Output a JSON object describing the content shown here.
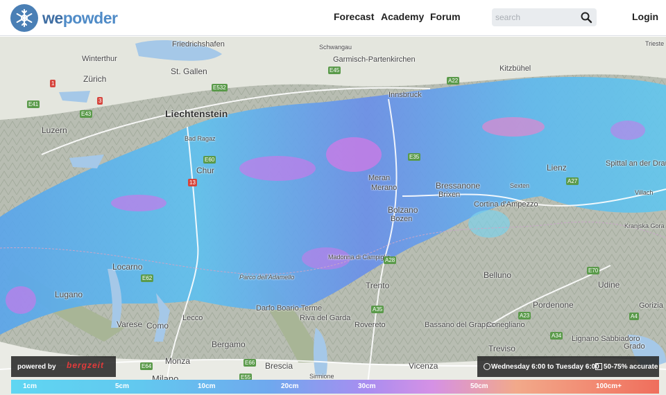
{
  "header": {
    "logo": {
      "we": "we",
      "powder": "powder"
    },
    "nav": [
      "Forecast",
      "Academy",
      "Forum"
    ],
    "search_placeholder": "search",
    "login": "Login"
  },
  "map": {
    "places": [
      "Friedrichshafen",
      "Winterthur",
      "Zürich",
      "St. Gallen",
      "Liechtenstein",
      "Luzern",
      "Chur",
      "Bad Ragaz",
      "Garmisch-Partenkirchen",
      "Innsbruck",
      "Kitzbühel",
      "Meran",
      "Merano",
      "Bressanone",
      "Brixen",
      "Bolzano",
      "Bozen",
      "Lienz",
      "Spittal an der Drau",
      "Cortina d'Ampezzo",
      "Locarno",
      "Lugano",
      "Varese",
      "Como",
      "Lecco",
      "Bergamo",
      "Monza",
      "Milano",
      "Brescia",
      "Trento",
      "Rovereto",
      "Riva del Garda",
      "Darfo Boario Terme",
      "Belluno",
      "Bassano del Grappa",
      "Conegliano",
      "Treviso",
      "Vicenza",
      "Pordenone",
      "Udine",
      "Gorizia",
      "Lignano Sabbiadoro",
      "Grado",
      "Madonna di Campiglio",
      "Parco dell'Adamello",
      "Sirmione",
      "Schwangau",
      "Villach",
      "Kranjska Gora",
      "Sexten",
      "Trieste"
    ],
    "roads": [
      "E41",
      "E43",
      "E60",
      "E532",
      "E45",
      "A22",
      "E35",
      "E62",
      "E64",
      "E66",
      "A27",
      "A28",
      "A23",
      "E70",
      "A34",
      "A4",
      "A35",
      "E55",
      "13",
      "1",
      "3"
    ]
  },
  "overlay": {
    "powered_by": "powered by",
    "brand": "bergzeit",
    "period": "Wednesday 6:00 to Tuesday 6:00",
    "accuracy": "50-75% accurate"
  },
  "legend": [
    "1cm",
    "5cm",
    "10cm",
    "20cm",
    "30cm",
    "50cm",
    "100cm+"
  ],
  "colors": {
    "brand": "#4a7fb5",
    "snow_low": "#5fd6f2",
    "snow_mid": "#6fa8ee",
    "snow_high": "#d591e5",
    "snow_max": "#ef6e5c",
    "overlay_bg": "#282828"
  }
}
